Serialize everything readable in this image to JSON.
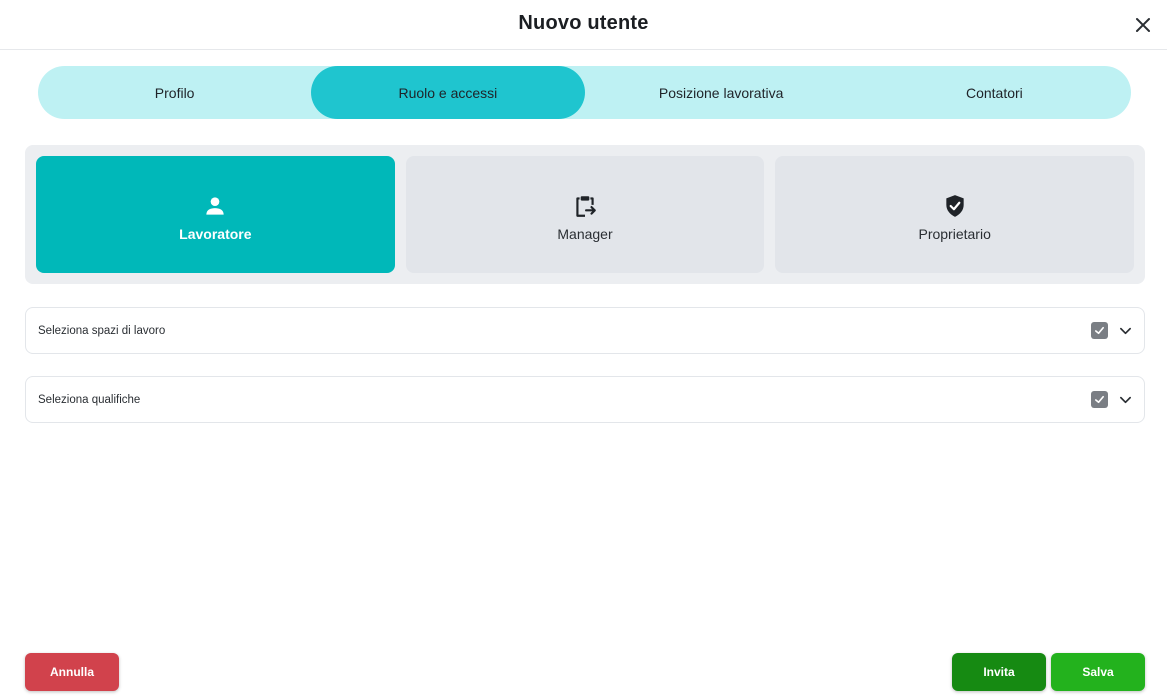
{
  "header": {
    "title": "Nuovo utente"
  },
  "tabs": [
    {
      "label": "Profilo",
      "active": false
    },
    {
      "label": "Ruolo e accessi",
      "active": true
    },
    {
      "label": "Posizione lavorativa",
      "active": false
    },
    {
      "label": "Contatori",
      "active": false
    }
  ],
  "roles": [
    {
      "label": "Lavoratore",
      "icon": "person-icon",
      "selected": true
    },
    {
      "label": "Manager",
      "icon": "clipboard-transfer-icon",
      "selected": false
    },
    {
      "label": "Proprietario",
      "icon": "shield-check-icon",
      "selected": false
    }
  ],
  "selects": [
    {
      "label": "Seleziona spazi di lavoro",
      "checked": true
    },
    {
      "label": "Seleziona qualifiche",
      "checked": true
    }
  ],
  "footer": {
    "cancel_label": "Annulla",
    "invite_label": "Invita",
    "save_label": "Salva"
  },
  "colors": {
    "accent": "#00b8b9",
    "tab_active": "#1fc5cf",
    "tab_bg": "#bef1f3",
    "cancel": "#d1424c",
    "invite": "#168a12",
    "save": "#23b21d"
  }
}
